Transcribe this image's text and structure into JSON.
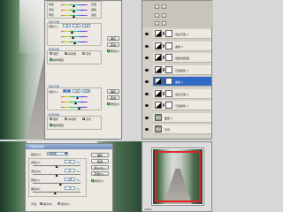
{
  "dialog_top": {
    "section1_header": "色调平衡",
    "tone_labels": [
      "青色",
      "洋红",
      "黄色"
    ],
    "tone_right_labels": [
      "红色",
      "绿色",
      "蓝色"
    ],
    "section2_header": "色彩平衡",
    "section2_values_label": "色阶(L):",
    "section2_values": [
      "-6",
      "-4",
      "+2"
    ],
    "section3_header": "色调平衡",
    "section3_radios": [
      "阴影",
      "中间调",
      "高光"
    ],
    "preserve_label": "保持明度",
    "section4_header": "色彩平衡",
    "section4_values_label": "色阶(L):",
    "section4_values": [
      "10",
      "+6",
      "+16"
    ],
    "section5_header": "色调平衡",
    "buttons": [
      "确定",
      "取消"
    ],
    "preview_label": "预览(P)"
  },
  "dialog_bottom": {
    "title": "可选颜色选项",
    "color_label": "颜色(O):",
    "color_value": "中性色",
    "sliders": [
      {
        "label": "青色(C):",
        "value": "0",
        "pct": 0.5
      },
      {
        "label": "洋红(M):",
        "value": "0",
        "pct": 0.5
      },
      {
        "label": "黄色(Y):",
        "value": "+8",
        "pct": 0.58
      },
      {
        "label": "黑色(B):",
        "value": "-3",
        "pct": 0.47
      }
    ],
    "unit": "%",
    "method_label": "方法:",
    "method_options": [
      "相对(R)",
      "绝对(A)"
    ],
    "buttons": [
      "确定",
      "取消",
      "载入(L)...",
      "存储(S)..."
    ],
    "preview_label": "预览(P)"
  },
  "layers_panel": {
    "layers": [
      {
        "name": "色彩平衡 1",
        "type": "adj",
        "active": false
      },
      {
        "name": "曲线 1",
        "type": "adj",
        "active": false
      },
      {
        "name": "色相/饱和度",
        "type": "adj",
        "active": false
      },
      {
        "name": "可选颜色 1",
        "type": "adj",
        "active": false
      },
      {
        "name": "曲线 2",
        "type": "adj",
        "active": true
      },
      {
        "name": "色彩平衡 2",
        "type": "adj",
        "active": false
      },
      {
        "name": "可选颜色 2",
        "type": "adj",
        "active": false
      },
      {
        "name": "图层 1",
        "type": "img",
        "active": false
      },
      {
        "name": "背景",
        "type": "img",
        "active": false
      }
    ]
  },
  "navigator": {
    "zoom": "100%"
  },
  "colors": {
    "accent": "#316ac5",
    "dialog_bg": "#ece9e2",
    "panel_bg": "#d4d0c8"
  }
}
